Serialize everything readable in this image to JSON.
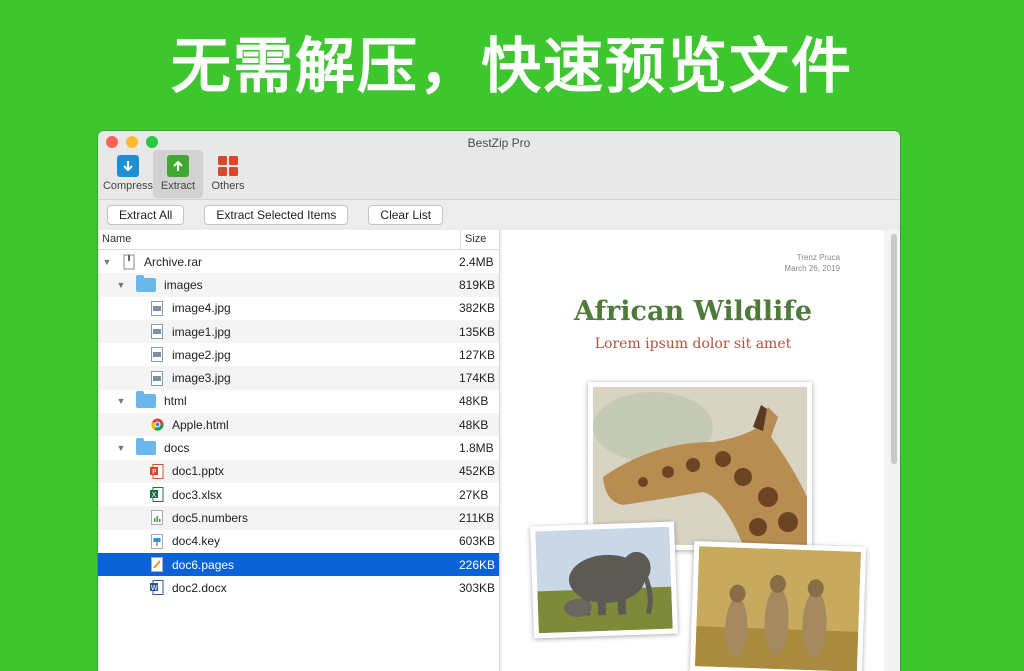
{
  "banner": {
    "text": "无需解压，快速预览文件"
  },
  "window": {
    "title": "BestZip Pro"
  },
  "toolbar": {
    "buttons": [
      {
        "label": "Compress",
        "icon": "compress-icon",
        "color": "#1f8fd3"
      },
      {
        "label": "Extract",
        "icon": "extract-icon",
        "color": "#43a832"
      },
      {
        "label": "Others",
        "icon": "grid-icon",
        "color": "#d9462c"
      }
    ]
  },
  "actions": {
    "extract_all": "Extract All",
    "extract_selected": "Extract Selected Items",
    "clear_list": "Clear List"
  },
  "columns": {
    "name": "Name",
    "size": "Size"
  },
  "files": [
    {
      "name": "Archive.rar",
      "size": "2.4MB",
      "level": 0,
      "type": "archive",
      "expanded": true
    },
    {
      "name": "images",
      "size": "819KB",
      "level": 1,
      "type": "folder",
      "expanded": true
    },
    {
      "name": "image4.jpg",
      "size": "382KB",
      "level": 2,
      "type": "image"
    },
    {
      "name": "image1.jpg",
      "size": "135KB",
      "level": 2,
      "type": "image"
    },
    {
      "name": "image2.jpg",
      "size": "127KB",
      "level": 2,
      "type": "image"
    },
    {
      "name": "image3.jpg",
      "size": "174KB",
      "level": 2,
      "type": "image"
    },
    {
      "name": "html",
      "size": "48KB",
      "level": 1,
      "type": "folder",
      "expanded": true
    },
    {
      "name": "Apple.html",
      "size": "48KB",
      "level": 2,
      "type": "html"
    },
    {
      "name": "docs",
      "size": "1.8MB",
      "level": 1,
      "type": "folder",
      "expanded": true
    },
    {
      "name": "doc1.pptx",
      "size": "452KB",
      "level": 2,
      "type": "pptx"
    },
    {
      "name": "doc3.xlsx",
      "size": "27KB",
      "level": 2,
      "type": "xlsx"
    },
    {
      "name": "doc5.numbers",
      "size": "211KB",
      "level": 2,
      "type": "numbers"
    },
    {
      "name": "doc4.key",
      "size": "603KB",
      "level": 2,
      "type": "key"
    },
    {
      "name": "doc6.pages",
      "size": "226KB",
      "level": 2,
      "type": "pages",
      "selected": true
    },
    {
      "name": "doc2.docx",
      "size": "303KB",
      "level": 2,
      "type": "docx"
    }
  ],
  "preview": {
    "author": "Trenz Pruca",
    "date": "March 26, 2019",
    "title": "African Wildlife",
    "subtitle": "Lorem ipsum dolor sit amet"
  }
}
